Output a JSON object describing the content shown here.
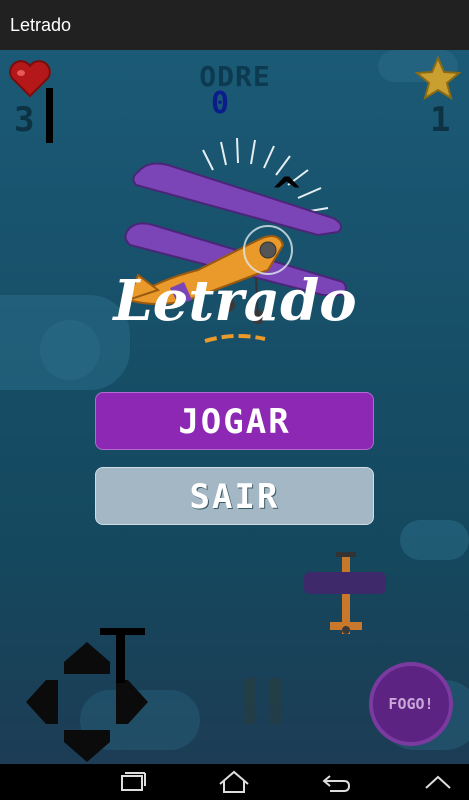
{
  "app": {
    "title": "Letrado"
  },
  "hud": {
    "lives": "3",
    "odre_label": "ODRE",
    "score": "0",
    "stars": "1"
  },
  "logo": {
    "text": "Letrado",
    "caret": "^"
  },
  "menu": {
    "play_label": "JOGAR",
    "exit_label": "SAIR"
  },
  "controls": {
    "fire_label": "FOGO!"
  },
  "colors": {
    "play_button": "#8d28b5",
    "exit_button": "#a3b8c4",
    "sky": "#1b5a76"
  },
  "icons": [
    "heart-icon",
    "star-icon",
    "dpad-up-icon",
    "dpad-down-icon",
    "dpad-left-icon",
    "dpad-right-icon",
    "pause-icon",
    "recents-icon",
    "home-icon",
    "back-icon",
    "up-icon"
  ]
}
